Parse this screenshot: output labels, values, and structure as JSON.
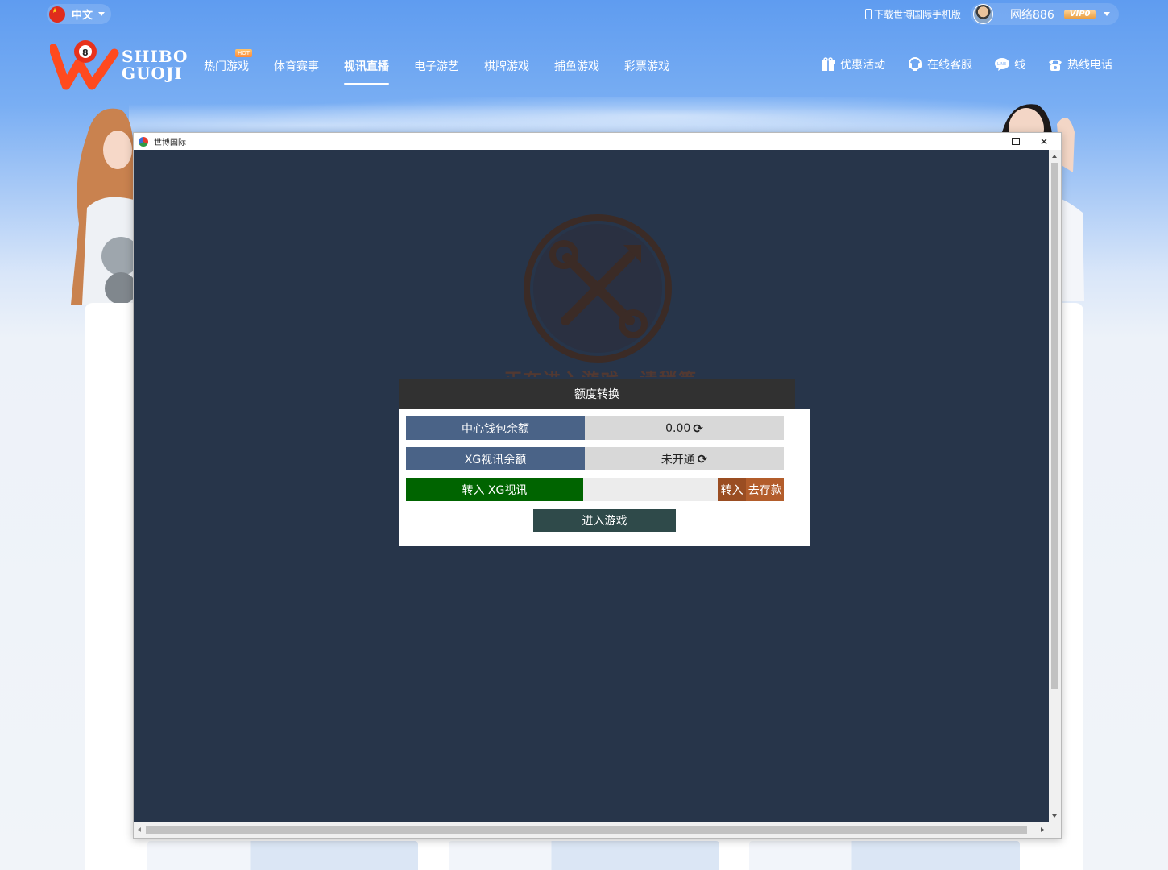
{
  "header": {
    "language": "中文",
    "download_text": "下载世博国际手机版",
    "username": "网络886",
    "vip_badge": "VIP0",
    "logo_line1": "SHIBO",
    "logo_line2": "GUOJI",
    "nav": [
      {
        "label": "热门游戏",
        "badge": "HOT"
      },
      {
        "label": "体育赛事"
      },
      {
        "label": "视讯直播"
      },
      {
        "label": "电子游艺"
      },
      {
        "label": "棋牌游戏"
      },
      {
        "label": "捕鱼游戏"
      },
      {
        "label": "彩票游戏"
      }
    ],
    "active_nav": "视讯直播",
    "right_nav": [
      {
        "label": "优惠活动",
        "icon": "gift-icon"
      },
      {
        "label": "在线客服",
        "icon": "headset-icon"
      },
      {
        "label": "线",
        "icon": "line-chat-icon"
      },
      {
        "label": "热线电话",
        "icon": "phone-icon"
      }
    ]
  },
  "window": {
    "title": "世博国际",
    "loading_text": "正在进入游戏，请稍等"
  },
  "dialog": {
    "title": "额度转换",
    "rows": [
      {
        "label": "中心钱包余额",
        "value": "0.00"
      },
      {
        "label": "XG视讯余额",
        "value": "未开通"
      }
    ],
    "transfer_label": "转入 XG视讯",
    "transfer_button": "转入",
    "deposit_button": "去存款",
    "enter_button": "进入游戏",
    "amount_placeholder": ""
  },
  "colors": {
    "header_blue": "#5f9cf0",
    "window_bg": "#27354a",
    "label_blue": "#4a6387",
    "label_green": "#006400",
    "transfer_brown": "#9a4d22",
    "enter_dark": "#2f4a4a"
  }
}
